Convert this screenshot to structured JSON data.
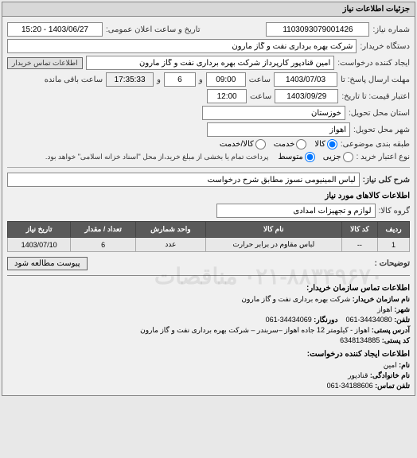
{
  "header": {
    "title": "جزئیات اطلاعات نیاز"
  },
  "top": {
    "lbl_number": "شماره نیاز:",
    "number": "1103093079001426",
    "lbl_announce": "تاریخ و ساعت اعلان عمومی:",
    "announce": "1403/06/27 - 15:20",
    "lbl_buyer_org": "دستگاه خریدار:",
    "buyer_org": "شرکت بهره برداری نفت و گاز مارون",
    "lbl_requester": "ایجاد کننده درخواست:",
    "requester": "امین قنادپور کارپرداز شرکت بهره برداری نفت و گاز مارون",
    "contact_btn": "اطلاعات تماس خریدار",
    "lbl_deadline": "مهلت ارسال پاسخ: تا",
    "deadline_date": "1403/07/03",
    "lbl_time": "ساعت",
    "deadline_time": "09:00",
    "lbl_and": "و",
    "deadline_remaining_num": "6",
    "deadline_remaining_time": "17:35:33",
    "remaining_suffix": "ساعت باقی مانده",
    "lbl_validity": "اعتبار قیمت: تا تاریخ:",
    "validity_date": "1403/09/29",
    "validity_time": "12:00",
    "lbl_province": "استان محل تحویل:",
    "province": "خوزستان",
    "lbl_city": "شهر محل تحویل:",
    "city": "اهواز",
    "lbl_category": "طبقه بندی موضوعی:",
    "cat_kala": "کالا",
    "cat_khadamat": "خدمت",
    "cat_both": "کالا/خدمت",
    "lbl_purchase_type": "نوع اعتبار خرید :",
    "pt_partial": "جزیی",
    "pt_medium": "متوسط",
    "payment_note": "پرداخت تمام یا بخشی از مبلغ خرید،از محل \"اسناد خزانه اسلامی\" خواهد بود."
  },
  "need": {
    "lbl_general": "شرح کلی نیاز:",
    "general": "لباس آلمینیومی نسوز مطابق شرح درخواست",
    "section_items": "اطلاعات کالاهای مورد نیاز",
    "lbl_group": "گروه کالا:",
    "group": "لوازم و تجهیزات امدادی"
  },
  "table": {
    "headers": {
      "row": "ردیف",
      "code": "کد کالا",
      "name": "نام کالا",
      "unit": "واحد شمارش",
      "qty": "تعداد / مقدار",
      "date": "تاریخ نیاز"
    },
    "rows": [
      {
        "row": "1",
        "code": "--",
        "name": "لباس مقاوم در برابر حرارت",
        "unit": "عدد",
        "qty": "6",
        "date": "1403/07/10"
      }
    ]
  },
  "actions": {
    "attach": "پیوست مطالعه شود",
    "lbl_notes": "توضیحات :"
  },
  "contact": {
    "section1_title": "اطلاعات تماس سازمان خریدار:",
    "lbl_org_name": "نام سازمان خریدار:",
    "org_name": "شرکت بهره برداری نفت و گاز مارون",
    "lbl_city": "شهر:",
    "city": "اهواز",
    "lbl_phone": "تلفن:",
    "phone": "34434080-061",
    "lbl_fax": "دورنگار:",
    "fax": "34434069-061",
    "lbl_address": "آدرس پستی:",
    "address": "اهواز - کیلومتر 12 جاده اهواز –سربندر – شرکت بهره برداری نفت و گاز مارون",
    "lbl_postal": "کد پستی:",
    "postal": "6348134885",
    "section2_title": "اطلاعات ایجاد کننده درخواست:",
    "lbl_fname": "نام:",
    "fname": "امین",
    "lbl_lname": "نام خانوادگی:",
    "lname": "قنادپور",
    "lbl_req_phone": "تلفن تماس:",
    "req_phone": "34188606-061"
  },
  "watermark": "۰۲۱-۸۸۳۴۹۶۷۰  مناقصات"
}
